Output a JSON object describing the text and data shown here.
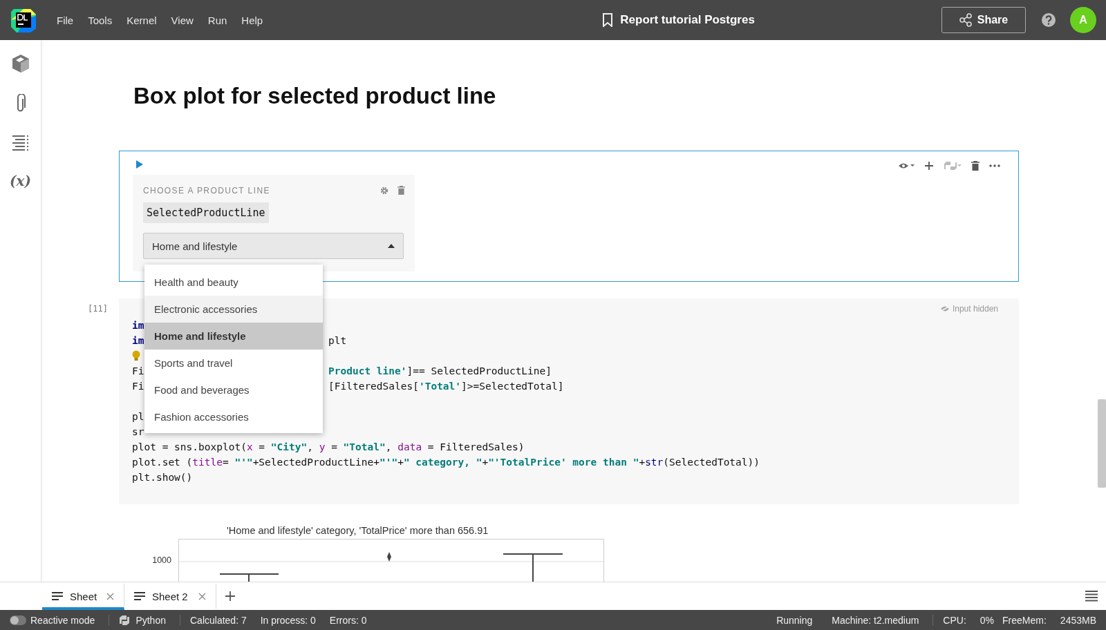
{
  "menu": [
    "File",
    "Tools",
    "Kernel",
    "View",
    "Run",
    "Help"
  ],
  "document_title": "Report tutorial Postgres",
  "share_button": "Share",
  "avatar": "A",
  "sidebar": [
    {
      "kind": "box"
    },
    {
      "kind": "clip"
    },
    {
      "kind": "outline"
    },
    {
      "kind": "text",
      "label": "(x)"
    }
  ],
  "heading": "Box plot for selected product line",
  "widget": {
    "label": "CHOOSE A PRODUCT LINE",
    "variable": "SelectedProductLine",
    "value": "Home and lifestyle",
    "open": true,
    "options": [
      {
        "label": "Health and beauty",
        "selected": false,
        "hovered": false
      },
      {
        "label": "Electronic accessories",
        "selected": false,
        "hovered": true
      },
      {
        "label": "Home and lifestyle",
        "selected": true,
        "hovered": false
      },
      {
        "label": "Sports and travel",
        "selected": false,
        "hovered": false
      },
      {
        "label": "Food and beverages",
        "selected": false,
        "hovered": false
      },
      {
        "label": "Fashion accessories",
        "selected": false,
        "hovered": false
      }
    ]
  },
  "code_cell": {
    "prompt": "[11]",
    "input_hidden": "Input hidden",
    "lines": [
      {
        "kind": "split",
        "left": [
          {
            "text": "im",
            "kind": "kw"
          }
        ]
      },
      {
        "kind": "split",
        "left": [
          {
            "text": "im",
            "kind": "kw"
          }
        ],
        "right": [
          {
            "text": "plt",
            "kind": "plain"
          }
        ]
      },
      {
        "kind": "hint"
      },
      {
        "kind": "split",
        "left": [
          {
            "text": "Fi",
            "kind": "plain"
          }
        ],
        "right": [
          {
            "text": "Product line'",
            "kind": "str"
          },
          {
            "text": "]== SelectedProductLine]",
            "kind": "plain"
          }
        ]
      },
      {
        "kind": "split",
        "left": [
          {
            "text": "Fi",
            "kind": "plain"
          }
        ],
        "right": [
          {
            "text": "[FilteredSales[",
            "kind": "plain"
          },
          {
            "text": "'Total'",
            "kind": "str"
          },
          {
            "text": "]>=SelectedTotal]",
            "kind": "plain"
          }
        ]
      },
      {
        "kind": "blank"
      },
      {
        "kind": "split",
        "left": [
          {
            "text": "pl",
            "kind": "plain"
          }
        ]
      },
      {
        "kind": "split",
        "left": [
          {
            "text": "sr",
            "kind": "plain"
          }
        ]
      },
      {
        "kind": "full",
        "left": [
          {
            "text": "plot = sns.boxplot(",
            "kind": "plain"
          },
          {
            "text": "x",
            "kind": "param"
          },
          {
            "text": " = ",
            "kind": "plain"
          },
          {
            "text": "\"City\"",
            "kind": "str"
          },
          {
            "text": ", ",
            "kind": "plain"
          },
          {
            "text": "y",
            "kind": "param"
          },
          {
            "text": " = ",
            "kind": "plain"
          },
          {
            "text": "\"Total\"",
            "kind": "str"
          },
          {
            "text": ", ",
            "kind": "plain"
          },
          {
            "text": "data",
            "kind": "param"
          },
          {
            "text": " = FilteredSales)",
            "kind": "plain"
          }
        ]
      },
      {
        "kind": "full",
        "left": [
          {
            "text": "plot.set (",
            "kind": "plain"
          },
          {
            "text": "title",
            "kind": "param"
          },
          {
            "text": "= ",
            "kind": "plain"
          },
          {
            "text": "\"'\"",
            "kind": "str"
          },
          {
            "text": "+SelectedProductLine+",
            "kind": "plain"
          },
          {
            "text": "\"'\"",
            "kind": "str"
          },
          {
            "text": "+",
            "kind": "plain"
          },
          {
            "text": "\" category, \"",
            "kind": "str"
          },
          {
            "text": "+",
            "kind": "plain"
          },
          {
            "text": "\"'TotalPrice' more than \"",
            "kind": "str"
          },
          {
            "text": "+",
            "kind": "plain"
          },
          {
            "text": "str",
            "kind": "builtin"
          },
          {
            "text": "(SelectedTotal))",
            "kind": "plain"
          }
        ]
      },
      {
        "kind": "full",
        "left": [
          {
            "text": "plt.show()",
            "kind": "plain"
          }
        ]
      }
    ]
  },
  "chart": {
    "title": "'Home and lifestyle' category, 'TotalPrice' more than 656.91",
    "y_tick": "1000"
  },
  "sheet_tabs": [
    {
      "label": "Sheet",
      "selected": true
    },
    {
      "label": "Sheet 2",
      "selected": false
    }
  ],
  "status": {
    "reactive_mode": {
      "label": "Reactive mode",
      "on": false
    },
    "language": "Python",
    "calculated": "Calculated: 7",
    "in_process": "In process: 0",
    "errors": "Errors: 0",
    "kernel_state": "Running",
    "machine": "Machine: t2.medium",
    "cpu_label": "CPU:",
    "cpu_value": "0%",
    "mem_label": "FreeMem:",
    "mem_value": "2453MB"
  }
}
